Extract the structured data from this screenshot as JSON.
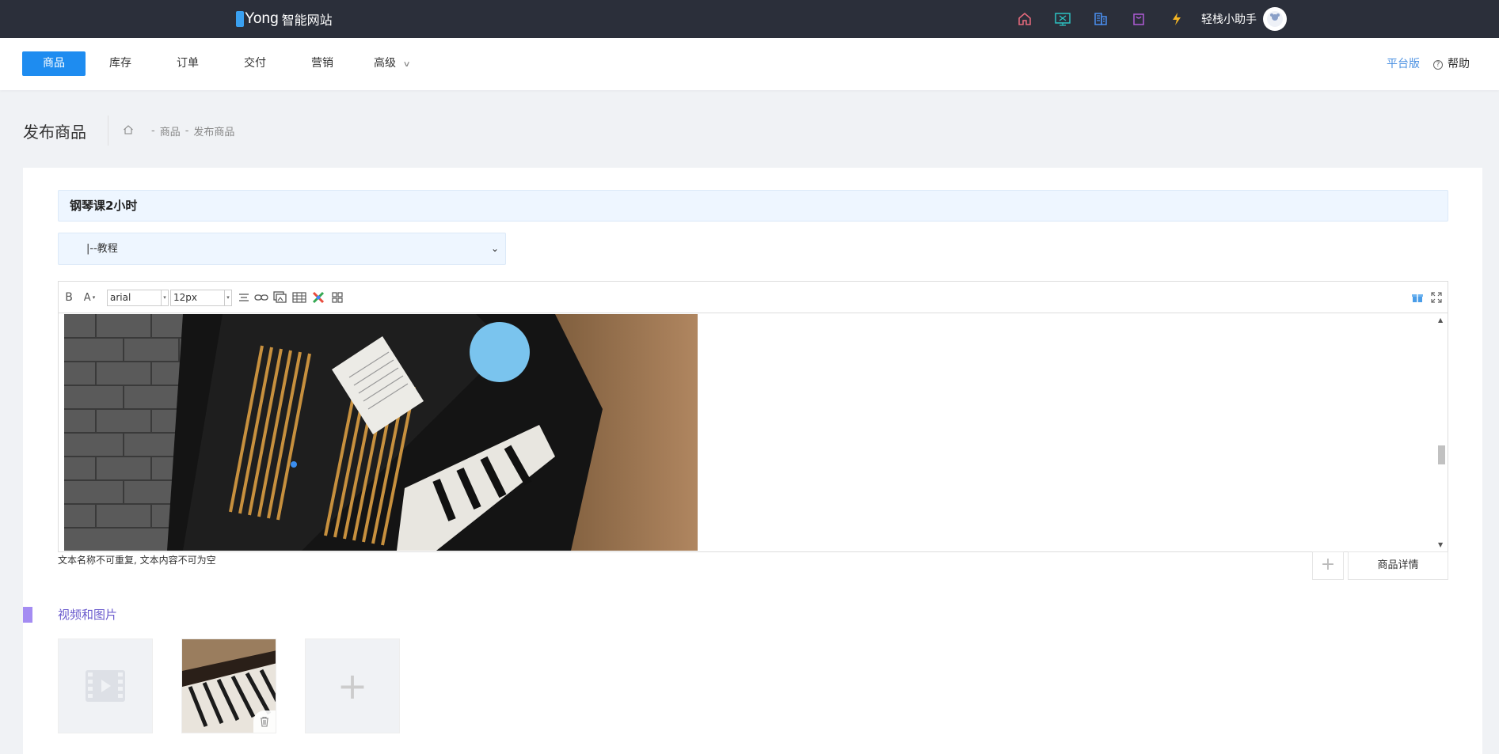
{
  "header": {
    "logo_i": "i",
    "logo_text": "Yong",
    "logo_sub": "智能网站",
    "icons": [
      "home-icon",
      "monitor-icon",
      "building-icon",
      "bag-icon",
      "lightning-icon"
    ],
    "user_name": "轻栈小助手"
  },
  "nav": {
    "items": [
      "商品",
      "库存",
      "订单",
      "交付",
      "营销",
      "高级"
    ],
    "active": "商品",
    "platform": "平台版",
    "help": "帮助"
  },
  "page": {
    "title": "发布商品",
    "breadcrumb": [
      "商品",
      "发布商品"
    ]
  },
  "form": {
    "product_name": "钢琴课2小时",
    "category": "|--教程",
    "editor": {
      "font": "arial",
      "size": "12px"
    },
    "hint": "文本名称不可重复, 文本内容不可为空",
    "detail_button": "商品详情",
    "media_section": "视频和图片"
  },
  "colors": {
    "topbar": "#2b2f3a",
    "primary": "#1e8cf0",
    "section_accent": "#a48cf2"
  }
}
